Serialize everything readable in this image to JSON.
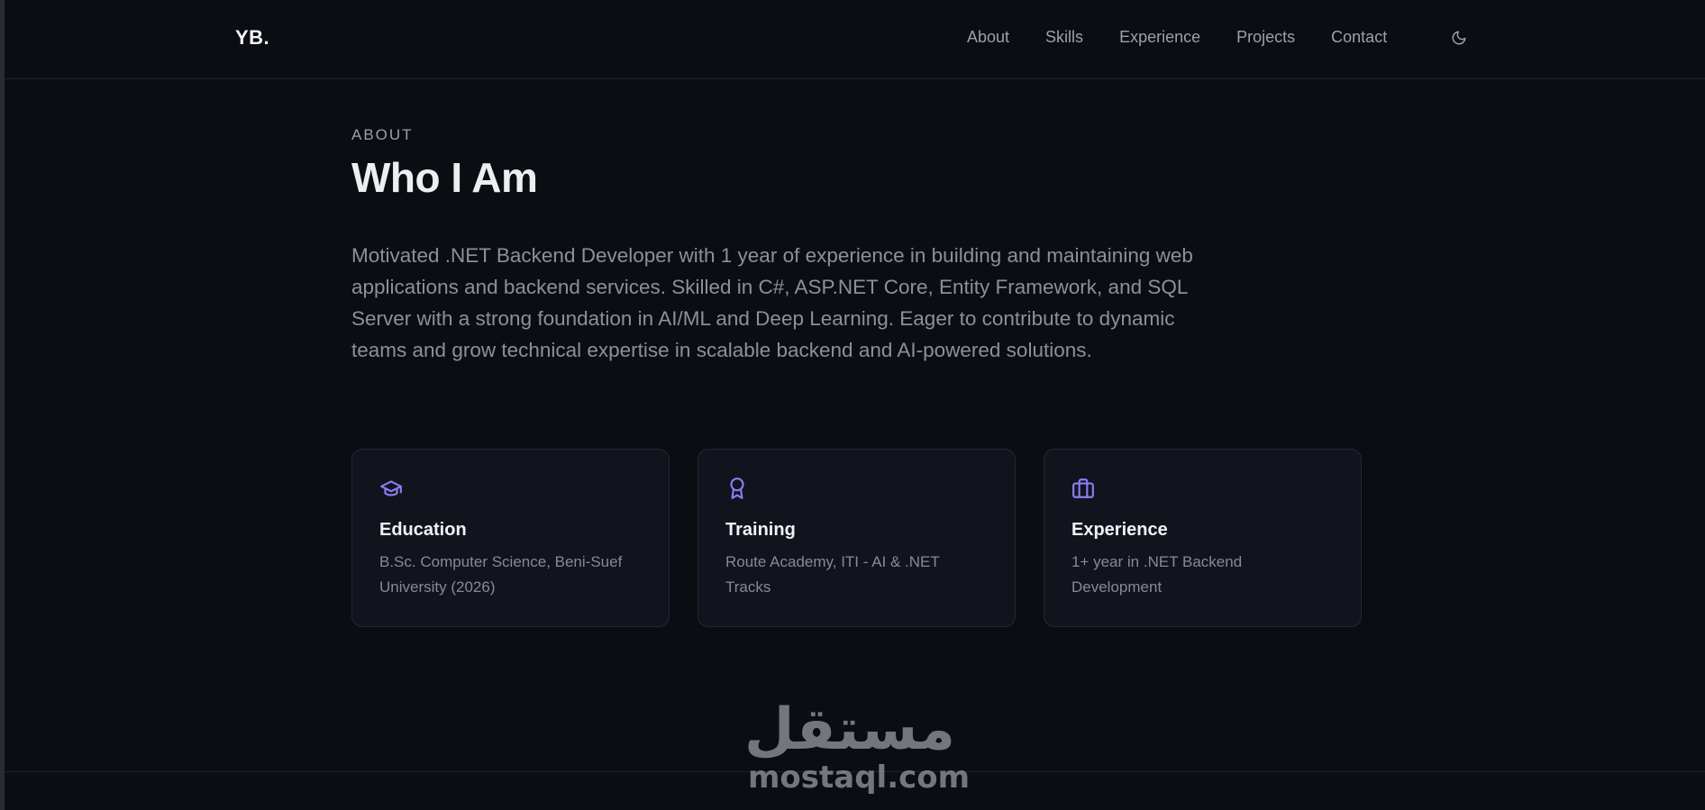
{
  "nav": {
    "logo": "YB.",
    "links": [
      "About",
      "Skills",
      "Experience",
      "Projects",
      "Contact"
    ],
    "theme_icon": "moon-icon"
  },
  "about": {
    "eyebrow": "ABOUT",
    "title": "Who I Am",
    "bio": "Motivated .NET Backend Developer with 1 year of experience in building and maintaining web applications and backend services. Skilled in C#, ASP.NET Core, Entity Framework, and SQL Server with a strong foundation in AI/ML and Deep Learning. Eager to contribute to dynamic teams and grow technical expertise in scalable backend and AI-powered solutions."
  },
  "cards": [
    {
      "icon": "graduation-cap-icon",
      "title": "Education",
      "text": "B.Sc. Computer Science, Beni-Suef University (2026)"
    },
    {
      "icon": "award-icon",
      "title": "Training",
      "text": "Route Academy, ITI - AI & .NET Tracks"
    },
    {
      "icon": "briefcase-icon",
      "title": "Experience",
      "text": "1+ year in .NET Backend Development"
    }
  ],
  "watermark": {
    "arabic": "مستقل",
    "latin": "mostaql.com"
  },
  "colors": {
    "background": "#0b0d12",
    "card_background": "#11141c",
    "accent_icon": "#8b7cf6",
    "muted_text": "#8b909c"
  }
}
